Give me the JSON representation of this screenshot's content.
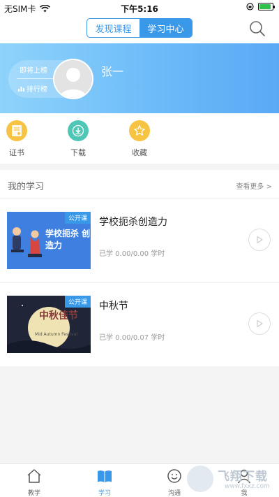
{
  "status_bar": {
    "carrier": "无SIM卡",
    "time": "下午5:16"
  },
  "nav": {
    "tabs": [
      "发现课程",
      "学习中心"
    ],
    "active_tab": 1
  },
  "profile": {
    "upcoming_label": "即将上榜",
    "rank_label": "排行榜",
    "name": "张一"
  },
  "actions": [
    {
      "label": "证书",
      "icon": "certificate-icon",
      "color": "#f6c342"
    },
    {
      "label": "下载",
      "icon": "download-icon",
      "color": "#4fc6b6"
    },
    {
      "label": "收藏",
      "icon": "star-icon",
      "color": "#f6c342"
    }
  ],
  "learning": {
    "title": "我的学习",
    "more": "查看更多 >",
    "courses": [
      {
        "title": "学校扼杀创造力",
        "progress": "已学 0.00/0.00 学时",
        "badge": "公开课",
        "thumb_text": "学校扼杀 创造力"
      },
      {
        "title": "中秋节",
        "progress": "已学 0.00/0.07 学时",
        "badge": "公开课",
        "thumb_text": "中秋佳节",
        "thumb_sub": "Mid Autumn Festival"
      }
    ]
  },
  "tabbar": {
    "items": [
      {
        "label": "教学",
        "icon": "house-icon"
      },
      {
        "label": "学习",
        "icon": "book-icon"
      },
      {
        "label": "沟通",
        "icon": "chat-icon"
      },
      {
        "label": "我",
        "icon": "person-icon"
      }
    ],
    "active": 1
  },
  "watermark": {
    "text": "飞翔下载",
    "url": "www.fxxz.com"
  },
  "colors": {
    "accent": "#3a98e8",
    "banner": "#6dbbf8"
  }
}
